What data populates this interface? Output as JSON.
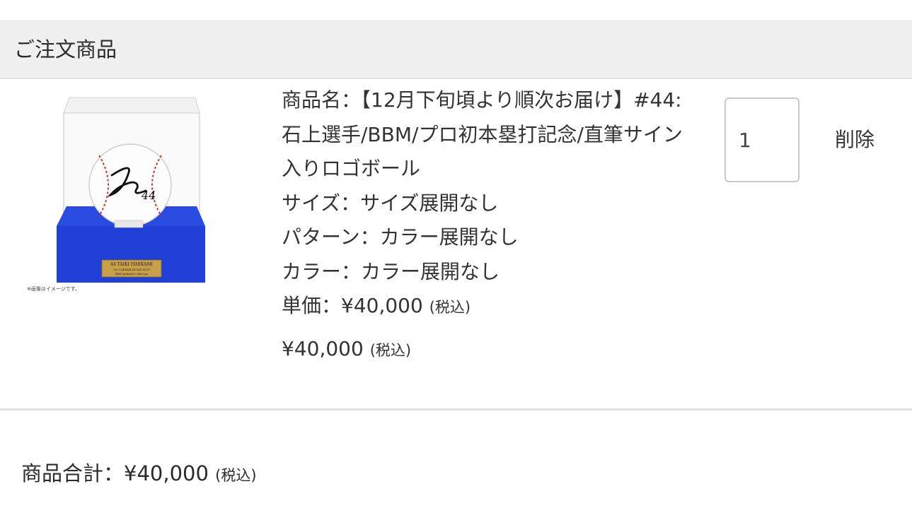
{
  "section": {
    "title": "ご注文商品"
  },
  "item": {
    "image": {
      "plate_line1": "44 TAIKI ISHIKAMI",
      "plate_line2": "1st CAREER HOME RUN",
      "plate_line3": "BBM Authentic Collection",
      "caption": "※画像はイメージです。",
      "signature": "44"
    },
    "name_line": "商品名：【12月下旬頃より順次お届け】#44:石上選手/BBM/プロ初本塁打記念/直筆サイン入りロゴボール",
    "size_line": "サイズ：サイズ展開なし",
    "pattern_line": "パターン：カラー展開なし",
    "color_line": "カラー：カラー展開なし",
    "unit_price_label": "単価：¥40,000",
    "tax_label": "(税込)",
    "subtotal": "¥40,000",
    "quantity": "1",
    "delete_label": "削除"
  },
  "total": {
    "label": "商品合計：¥40,000",
    "tax_label": "(税込)"
  },
  "colors": {
    "header_bg": "#f0f0f0",
    "divider": "#e2e2e2",
    "text": "#333333",
    "case_base_blue": "#1f3fd6",
    "plate_gold": "#c9a04a"
  }
}
